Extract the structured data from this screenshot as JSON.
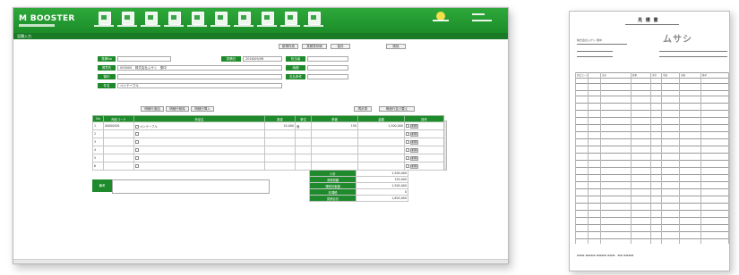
{
  "app": {
    "brand": "M BOOSTER",
    "nav_items": [
      "",
      "",
      "",
      "",
      "",
      "",
      "",
      "",
      "",
      ""
    ],
    "breadcrumb": "見積入力"
  },
  "form": {
    "labels": {
      "estimate_no": "見積No",
      "date": "見積日",
      "customer": "得意先",
      "honorific": "御中",
      "subject": "件名",
      "status": "担当者",
      "delivery": "納期",
      "payment": "支払条件"
    },
    "values": {
      "estimate_no": "",
      "date": "2016/09/06",
      "customer": "000000　株式会社ムサシ　御中",
      "subject": "ペンテーブル",
      "status": "",
      "delivery": "",
      "payment": ""
    },
    "top_buttons": [
      "新規作成",
      "見積書印刷",
      "保存",
      "削除"
    ],
    "row_buttons": [
      "明細行追加",
      "明細行削除",
      "明細行挿入"
    ],
    "right_buttons": [
      "再計算",
      "明細行並び替え"
    ]
  },
  "detail": {
    "headers": [
      "No",
      "商品コード",
      "商品名",
      "数量",
      "単位",
      "単価",
      "金額",
      "操作"
    ],
    "rows": [
      {
        "no": "1",
        "code": "00000001",
        "name": "ペンテーブル",
        "qty": "10,000",
        "unit": "個",
        "price": "150",
        "amount": "1,500,000"
      },
      {
        "no": "2",
        "code": "",
        "name": "",
        "qty": "",
        "unit": "",
        "price": "",
        "amount": ""
      },
      {
        "no": "3",
        "code": "",
        "name": "",
        "qty": "",
        "unit": "",
        "price": "",
        "amount": ""
      },
      {
        "no": "4",
        "code": "",
        "name": "",
        "qty": "",
        "unit": "",
        "price": "",
        "amount": ""
      },
      {
        "no": "5",
        "code": "",
        "name": "",
        "qty": "",
        "unit": "",
        "price": "",
        "amount": ""
      },
      {
        "no": "6",
        "code": "",
        "name": "",
        "qty": "",
        "unit": "",
        "price": "",
        "amount": ""
      }
    ],
    "row_action": "削除"
  },
  "memo": {
    "label": "備考"
  },
  "totals": [
    {
      "label": "小計",
      "value": "1,500,000"
    },
    {
      "label": "消費税額",
      "value": "120,000"
    },
    {
      "label": "課税対象額",
      "value": "1,500,000"
    },
    {
      "label": "非課税",
      "value": "0"
    },
    {
      "label": "見積合計",
      "value": "1,620,000"
    }
  ],
  "paper": {
    "title": "見 積 書",
    "company_logo": "ムサシ",
    "customer": "株式会社ムサシ 御中",
    "header_cols": [
      "商品コード",
      "品名",
      "数量",
      "単位",
      "単価",
      "金額",
      "備考"
    ]
  }
}
